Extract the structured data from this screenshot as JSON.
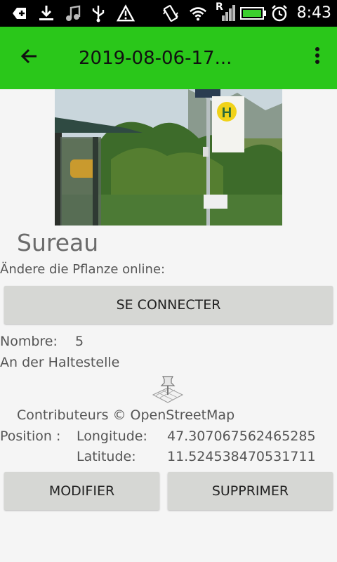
{
  "status_bar": {
    "time": "8:43",
    "roaming_indicator": "R",
    "icons": [
      "add-notification-icon",
      "download-icon",
      "music-icon",
      "usb-icon",
      "warning-icon",
      "vibrate-icon",
      "wifi-icon",
      "signal-icon",
      "battery-icon",
      "alarm-icon"
    ]
  },
  "toolbar": {
    "title": "2019-08-06-17...",
    "back_icon": "arrow-back-icon",
    "menu_icon": "more-vert-icon",
    "color": "#2ac71a"
  },
  "plant": {
    "name": "Sureau",
    "change_online_label": "Ändere die Pflanze online:",
    "connect_button": "SE CONNECTER",
    "count_label": "Nombre:",
    "count_value": "5",
    "location_description": "An der Haltestelle"
  },
  "map": {
    "icon": "map-pin-icon",
    "credit": "Contributeurs © OpenStreetMap"
  },
  "position": {
    "label": "Position :",
    "longitude_label": "Longitude:",
    "longitude_value": "47.307067562465285",
    "latitude_label": "Latitude:",
    "latitude_value": "11.524538470531711"
  },
  "actions": {
    "edit_button": "MODIFIER",
    "delete_button": "SUPPRIMER"
  }
}
